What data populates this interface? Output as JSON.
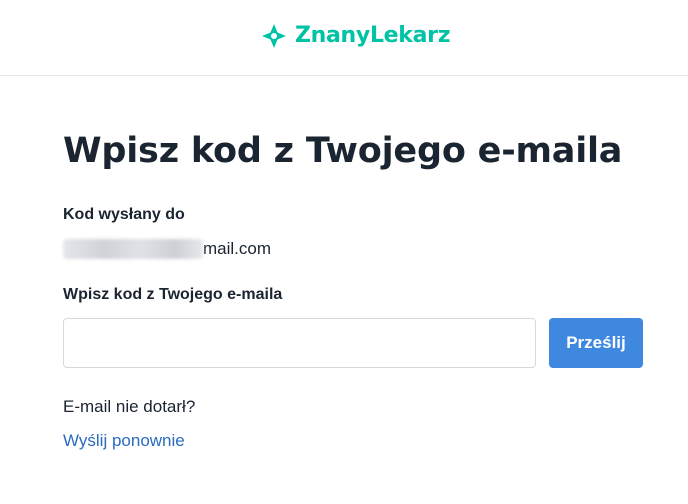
{
  "header": {
    "logo_text": "ZnanyLekarz",
    "logo_icon": "star-cross-icon",
    "brand_color": "#00c3a5"
  },
  "main": {
    "title": "Wpisz kod z Twojego e-maila",
    "sent_label": "Kod wysłany do",
    "email_visible_suffix": "mail.com",
    "code_label": "Wpisz kod z Twojego e-maila",
    "code_input_value": "",
    "submit_label": "Prześlij",
    "not_arrived_text": "E-mail nie dotarł?",
    "resend_link_text": "Wyślij ponownie"
  },
  "colors": {
    "button_bg": "#3f88e0",
    "link": "#2a6bc0",
    "text": "#1b2431"
  }
}
